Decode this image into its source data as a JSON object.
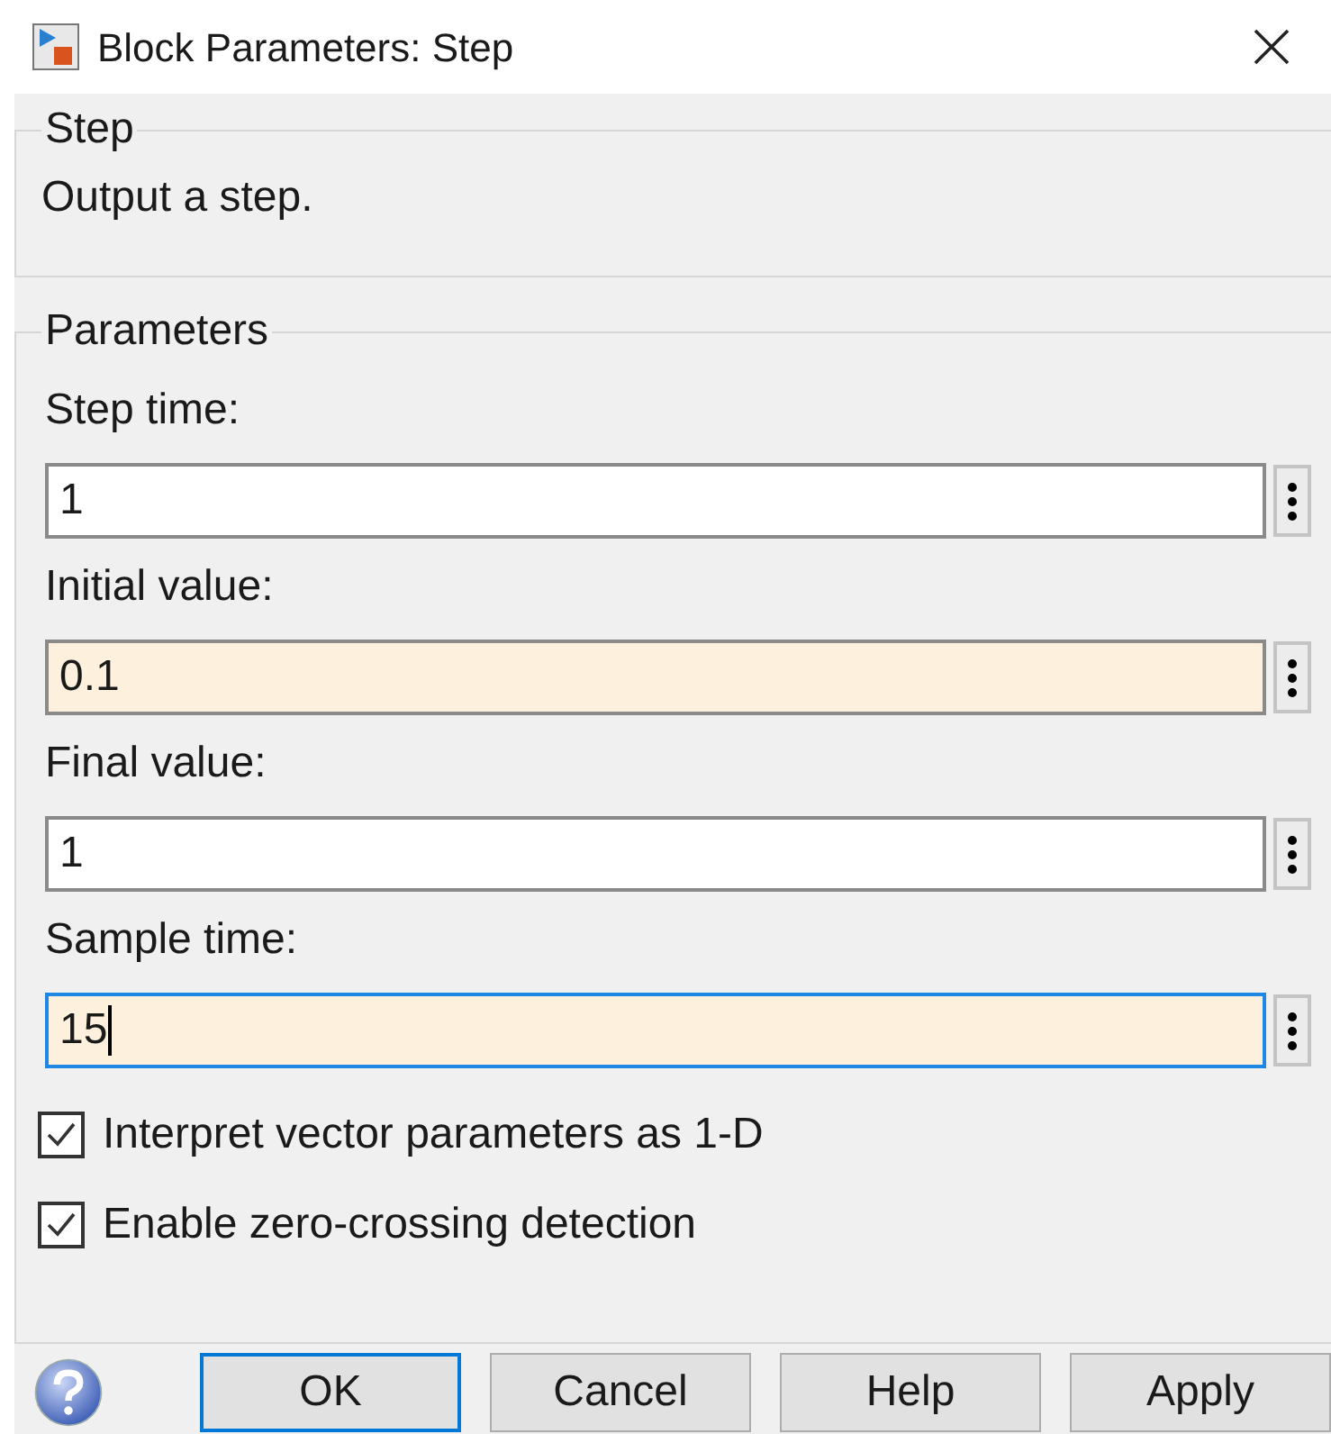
{
  "window": {
    "title": "Block Parameters: Step"
  },
  "description_group": {
    "title": "Step",
    "text": "Output a step."
  },
  "parameters_group": {
    "title": "Parameters",
    "fields": [
      {
        "label": "Step time:",
        "value": "1",
        "modified": false,
        "focused": false
      },
      {
        "label": "Initial value:",
        "value": "0.1",
        "modified": true,
        "focused": false
      },
      {
        "label": "Final value:",
        "value": "1",
        "modified": false,
        "focused": false
      },
      {
        "label": "Sample time:",
        "value": "15",
        "modified": true,
        "focused": true
      }
    ],
    "checkboxes": [
      {
        "label": "Interpret vector parameters as 1-D",
        "checked": true
      },
      {
        "label": "Enable zero-crossing detection",
        "checked": true
      }
    ]
  },
  "buttons": [
    {
      "label": "OK",
      "default": true
    },
    {
      "label": "Cancel",
      "default": false
    },
    {
      "label": "Help",
      "default": false
    },
    {
      "label": "Apply",
      "default": false
    }
  ]
}
